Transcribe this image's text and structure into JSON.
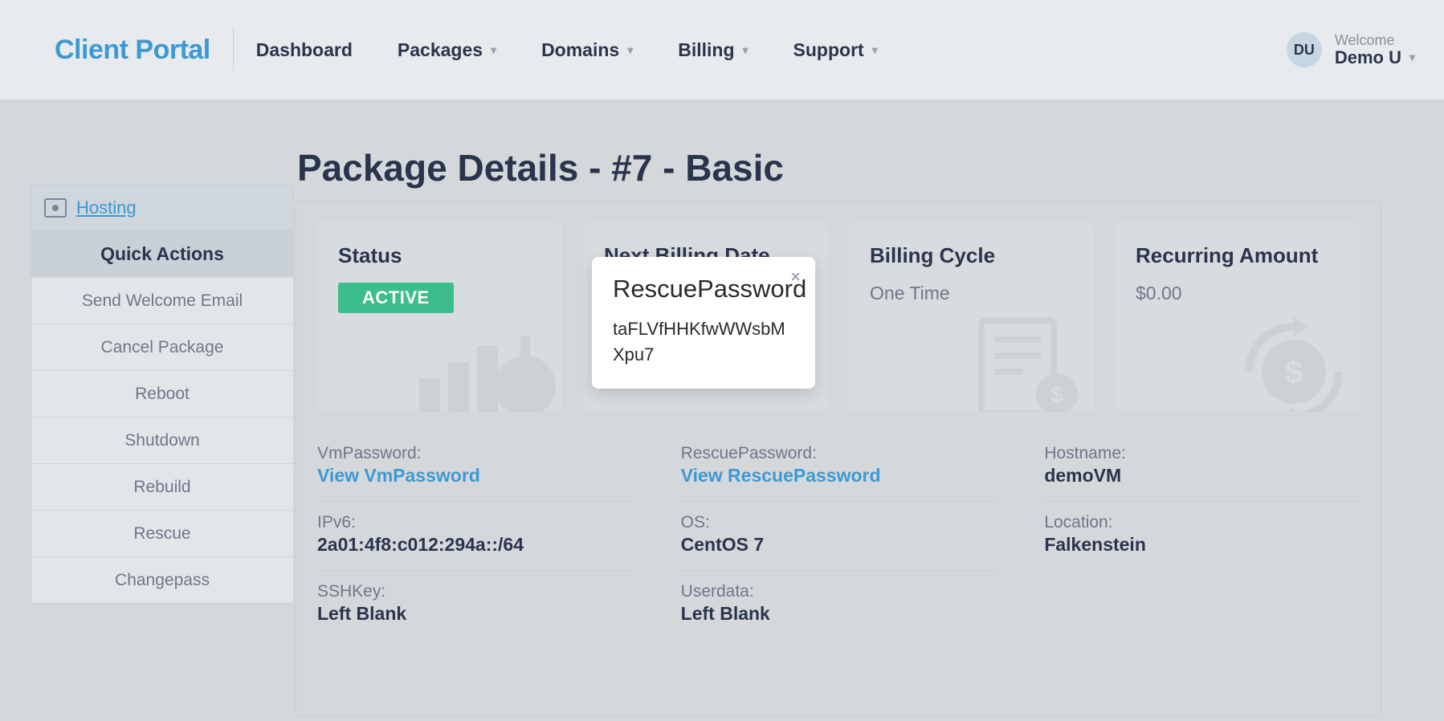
{
  "brand": "Client Portal",
  "nav": {
    "dashboard": "Dashboard",
    "packages": "Packages",
    "domains": "Domains",
    "billing": "Billing",
    "support": "Support"
  },
  "user": {
    "welcome": "Welcome",
    "name": "Demo U",
    "initials": "DU"
  },
  "page_title": "Package Details - #7 - Basic",
  "sidebar": {
    "hosting_tab": " Hosting",
    "quick_header": "Quick Actions",
    "actions": [
      "Send Welcome Email",
      "Cancel Package",
      "Reboot",
      "Shutdown",
      "Rebuild",
      "Rescue",
      "Changepass"
    ]
  },
  "cards": {
    "status": {
      "title": "Status",
      "badge": "ACTIVE"
    },
    "next_billing": {
      "title": "Next Billing Date"
    },
    "cycle": {
      "title": "Billing Cycle",
      "value": "One Time"
    },
    "recurring": {
      "title": "Recurring Amount",
      "value": "$0.00"
    }
  },
  "details": {
    "vmpassword": {
      "label": "VmPassword:",
      "link": "View VmPassword"
    },
    "rescuepassword": {
      "label": "RescuePassword:",
      "link": "View RescuePassword"
    },
    "hostname": {
      "label": "Hostname:",
      "value": "demoVM"
    },
    "ipv6": {
      "label": "IPv6:",
      "value": "2a01:4f8:c012:294a::/64"
    },
    "os": {
      "label": "OS:",
      "value": "CentOS 7"
    },
    "location": {
      "label": "Location:",
      "value": "Falkenstein"
    },
    "sshkey": {
      "label": "SSHKey:",
      "value": "Left Blank"
    },
    "userdata": {
      "label": "Userdata:",
      "value": "Left Blank"
    }
  },
  "popover": {
    "title": "RescuePassword",
    "body": "taFLVfHHKfwWWsbMXpu7"
  }
}
